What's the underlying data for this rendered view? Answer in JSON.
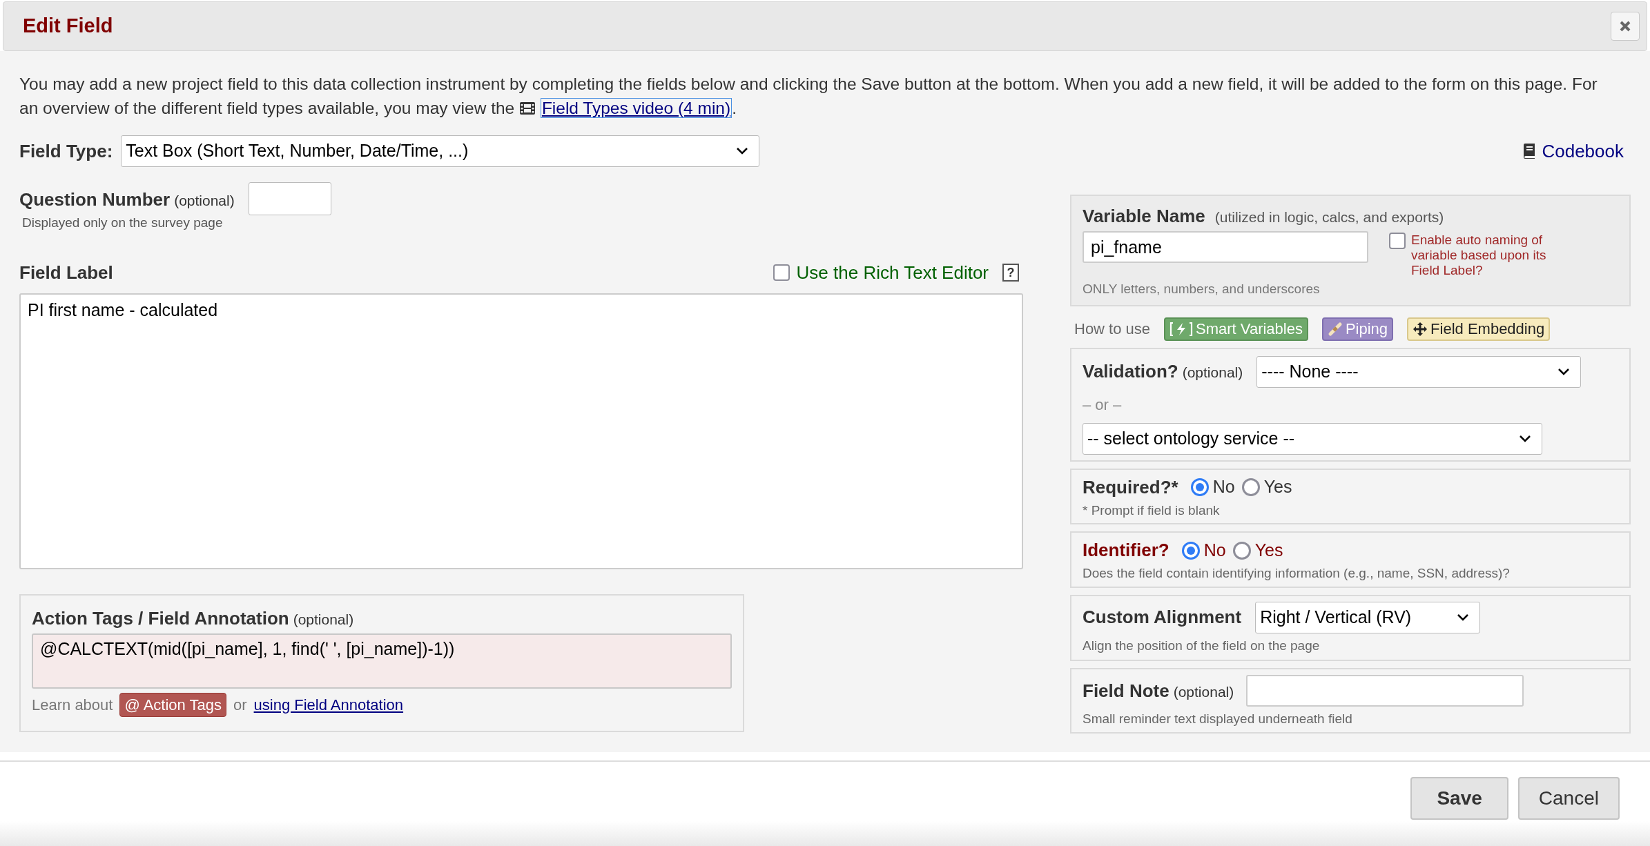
{
  "dialog": {
    "title": "Edit Field"
  },
  "intro": {
    "text": "You may add a new project field to this data collection instrument by completing the fields below and clicking the Save button at the bottom. When you add a new field, it will be added to the form on this page. For an overview of the different field types available, you may view the",
    "link": "Field Types video (4 min)",
    "after": "."
  },
  "field_type": {
    "label": "Field Type:",
    "value": "Text Box (Short Text, Number, Date/Time, ...)"
  },
  "codebook_link": "Codebook",
  "question_number": {
    "label": "Question Number",
    "optional": "(optional)",
    "hint": "Displayed only on the survey page"
  },
  "field_label": {
    "label": "Field Label",
    "value": "PI first name - calculated"
  },
  "rich_text_editor": {
    "label": "Use the Rich Text Editor",
    "checked": false,
    "help": "?"
  },
  "action_tags": {
    "label": "Action Tags / Field Annotation",
    "optional": "(optional)",
    "value": "@CALCTEXT(mid([pi_name], 1, find(' ', [pi_name])-1))",
    "learn": "Learn about",
    "badge": "@ Action Tags",
    "or": "or",
    "link": "using Field Annotation"
  },
  "variable_name": {
    "label": "Variable Name",
    "note": "(utilized in logic, calcs, and exports)",
    "value": "pi_fname",
    "hint": "ONLY letters, numbers, and underscores",
    "auto_naming": {
      "label": "Enable auto naming of variable based upon its Field Label?",
      "checked": false
    }
  },
  "how_to_use": {
    "label": "How to use",
    "badges": [
      {
        "label": "Smart Variables",
        "kind": "smart"
      },
      {
        "label": "Piping",
        "kind": "piping"
      },
      {
        "label": "Field Embedding",
        "kind": "embedding"
      }
    ]
  },
  "validation": {
    "label": "Validation?",
    "optional": "(optional)",
    "value": "---- None ----",
    "or": "– or –",
    "ontology": "-- select ontology service --"
  },
  "required": {
    "label": "Required?*",
    "hint": "* Prompt if field is blank",
    "options": [
      {
        "label": "No",
        "selected": true
      },
      {
        "label": "Yes",
        "selected": false
      }
    ]
  },
  "identifier": {
    "label": "Identifier?",
    "hint": "Does the field contain identifying information (e.g., name, SSN, address)?",
    "options": [
      {
        "label": "No",
        "selected": true
      },
      {
        "label": "Yes",
        "selected": false
      }
    ]
  },
  "custom_alignment": {
    "label": "Custom Alignment",
    "value": "Right / Vertical (RV)",
    "hint": "Align the position of the field on the page"
  },
  "field_note": {
    "label": "Field Note",
    "optional": "(optional)",
    "hint": "Small reminder text displayed underneath field"
  },
  "buttons": [
    {
      "label": "Save",
      "kind": "primary"
    },
    {
      "label": "Cancel",
      "kind": "secondary"
    }
  ]
}
